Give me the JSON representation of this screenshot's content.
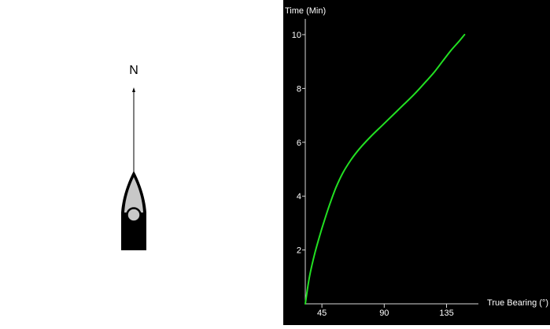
{
  "compass": {
    "north_label": "N"
  },
  "colors": {
    "chart_background": "#000000",
    "axis": "#d8d8d8",
    "curve": "#22e022",
    "text": "#ffffff",
    "boat_hull": "#000000",
    "boat_deck": "#c8c8c8"
  },
  "chart_data": {
    "type": "line",
    "xlabel": "True Bearing (°)",
    "ylabel": "Time (Min)",
    "x_ticks": [
      45,
      90,
      135
    ],
    "y_ticks": [
      2,
      4,
      6,
      8,
      10
    ],
    "xlim": [
      33,
      155
    ],
    "ylim": [
      0,
      10.8
    ],
    "grid": false,
    "series": [
      {
        "color": "#22e022",
        "x": [
          33,
          36,
          40,
          45,
          50,
          55,
          60,
          66,
          72,
          80,
          88,
          96,
          104,
          112,
          120,
          126,
          132,
          138,
          144,
          148
        ],
        "y": [
          0,
          1.0,
          1.9,
          2.8,
          3.6,
          4.3,
          4.85,
          5.35,
          5.75,
          6.2,
          6.6,
          7.0,
          7.4,
          7.8,
          8.25,
          8.6,
          9.0,
          9.4,
          9.75,
          10
        ]
      }
    ]
  }
}
